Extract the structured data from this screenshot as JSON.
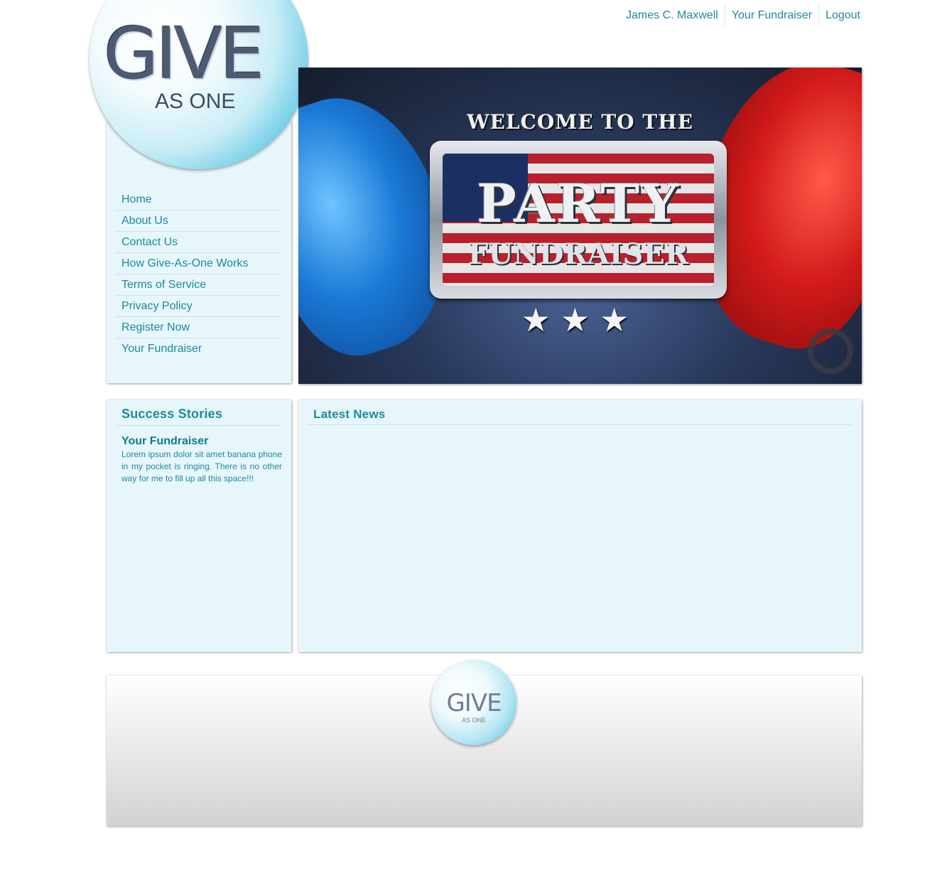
{
  "top_nav": {
    "user_name": "James C. Maxwell",
    "fundraiser": "Your Fundraiser",
    "logout": "Logout"
  },
  "logo": {
    "give": "GIVE",
    "as_one": "AS ONE"
  },
  "sidebar": {
    "items": [
      {
        "label": "Home"
      },
      {
        "label": "About Us"
      },
      {
        "label": "Contact Us"
      },
      {
        "label": "How Give-As-One Works"
      },
      {
        "label": "Terms of Service"
      },
      {
        "label": "Privacy Policy"
      },
      {
        "label": "Register Now"
      },
      {
        "label": "Your Fundraiser"
      }
    ]
  },
  "banner": {
    "welcome": "WELCOME TO THE",
    "party": "PARTY",
    "fundraiser": "FUNDRAISER",
    "stars": "★★★"
  },
  "success_stories": {
    "title": "Success Stories",
    "story_title": "Your Fundraiser",
    "story_text": "Lorem ipsum dolor sit amet banana phone in my pocket is ringing. There is no other way for me to fill up all this space!!!"
  },
  "latest_news": {
    "title": "Latest News"
  },
  "footer": {
    "give": "GIVE",
    "as_one": "AS ONE"
  },
  "colors": {
    "accent": "#1d8a9c",
    "panel_bg": "#e7f6fb",
    "logo_blue": "#2aa6cf"
  }
}
